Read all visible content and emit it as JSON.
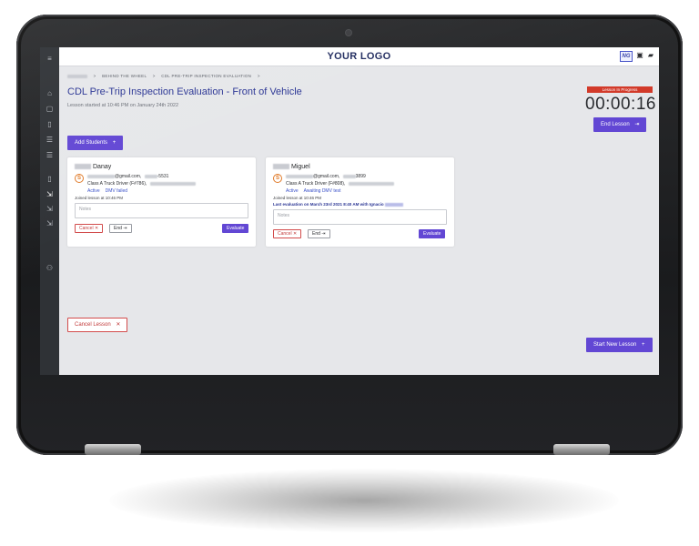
{
  "topbar": {
    "logo": "YOUR LOGO",
    "avatar_initials": "NG",
    "icons": [
      "calendar-icon",
      "chat-icon"
    ]
  },
  "sidebar": {
    "icons": [
      "menu-icon",
      "home-icon",
      "calendar-icon",
      "document-icon",
      "list-icon",
      "list-icon",
      "document-icon",
      "lesson-icon",
      "lesson-icon",
      "lesson-icon",
      "users-icon"
    ]
  },
  "breadcrumb": {
    "items": [
      "BEHIND THE WHEEL",
      "CDL PRE-TRIP INSPECTION EVALUATION"
    ]
  },
  "page": {
    "title": "CDL Pre-Trip Inspection Evaluation - Front of Vehicle",
    "started": "Lesson started at 10:46 PM on January 24th 2022"
  },
  "status": {
    "badge": "Lesson In Progress",
    "timer": "00:00:16"
  },
  "buttons": {
    "end_lesson": "End Lesson",
    "add_students": "Add Students",
    "cancel_lesson": "Cancel Lesson",
    "start_new_lesson": "Start New Lesson"
  },
  "students": [
    {
      "name": "Danay",
      "badge": "S",
      "email": "@gmail.com,",
      "phone": "-5531",
      "license": "Class A Truck Driver (F#786),",
      "tags": [
        "Active",
        "DMV failed"
      ],
      "joined": "Joined lesson at 10:46 PM",
      "last_eval": "",
      "notes_placeholder": "Notes",
      "cancel_label": "Cancel",
      "end_label": "End",
      "evaluate_label": "Evaluate"
    },
    {
      "name": "Miguel",
      "badge": "S",
      "email": "@gmail.com,",
      "phone": "3899",
      "license": "Class A Truck Driver (F#808),",
      "tags": [
        "Active",
        "Awaiting DMV test"
      ],
      "joined": "Joined lesson at 10:46 PM",
      "last_eval": "Last evaluation on March 23rd 2021 8:40 AM with Ignacio",
      "notes_placeholder": "Notes",
      "cancel_label": "Cancel",
      "end_label": "End",
      "evaluate_label": "Evaluate"
    }
  ],
  "colors": {
    "accent": "#6247d4",
    "title": "#2a3594",
    "danger": "#d23a2a",
    "student_badge": "#e07a28"
  }
}
